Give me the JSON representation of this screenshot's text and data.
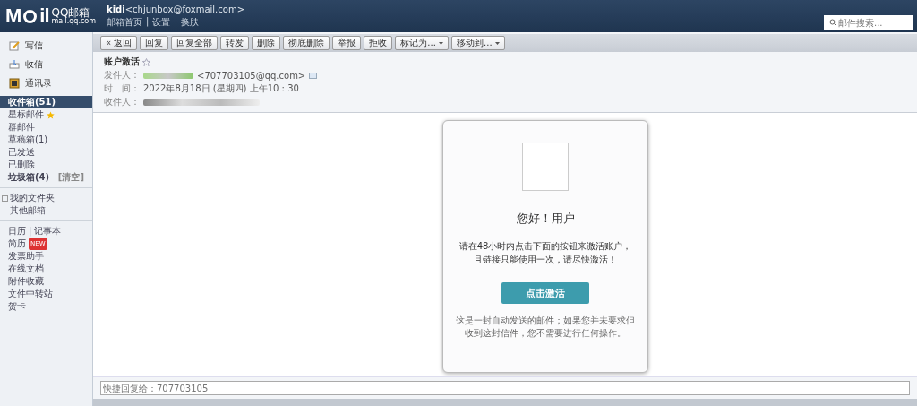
{
  "header": {
    "logo": "M",
    "logo_rest": "il",
    "brand": "QQ邮箱",
    "domain": "mail.qq.com",
    "user_name": "kidi",
    "user_email": "<chjunbox@foxmail.com>",
    "links": [
      {
        "label": "邮箱首页"
      },
      {
        "sep": "|",
        "label": "设置"
      },
      {
        "sep": "-",
        "label": "换肤"
      }
    ],
    "search": {
      "placeholder": "邮件搜索..."
    }
  },
  "sidebar": {
    "actions": [
      {
        "label": "写信",
        "kind": "write"
      },
      {
        "label": "收信",
        "kind": "receive"
      },
      {
        "label": "通讯录",
        "kind": "contacts"
      }
    ],
    "folders": [
      {
        "label": "收件箱(51)",
        "selected": true,
        "bold": true
      },
      {
        "label": "星标邮件",
        "selected": false,
        "bold": false,
        "star": true
      },
      {
        "label": "群邮件",
        "selected": false,
        "bold": false
      },
      {
        "label": "草稿箱(1)",
        "selected": false,
        "bold": false
      },
      {
        "label": "已发送",
        "selected": false,
        "bold": false
      },
      {
        "label": "已删除",
        "selected": false,
        "bold": false
      },
      {
        "label": "垃圾箱(4)",
        "selected": false,
        "bold": true,
        "action": "[清空]"
      }
    ],
    "groups": [
      {
        "label": "我的文件夹",
        "expanded": false
      },
      {
        "label": "其他邮箱"
      }
    ],
    "tools": [
      {
        "label": "日历",
        "sep": "|",
        "extra": "记事本"
      },
      {
        "label": "简历",
        "badge": "NEW"
      },
      {
        "label": "发票助手"
      },
      {
        "label": "在线文档"
      },
      {
        "label": "附件收藏"
      },
      {
        "label": "文件中转站"
      },
      {
        "label": "贺卡"
      }
    ]
  },
  "toolbar": [
    {
      "label": "« 返回",
      "dropdown": false
    },
    {
      "label": "回复",
      "dropdown": false
    },
    {
      "label": "回复全部",
      "dropdown": false
    },
    {
      "label": "转发",
      "dropdown": false
    },
    {
      "label": "删除",
      "dropdown": false
    },
    {
      "label": "彻底删除",
      "dropdown": false
    },
    {
      "label": "举报",
      "dropdown": false
    },
    {
      "label": "拒收",
      "dropdown": false
    },
    {
      "label": "标记为...",
      "dropdown": true
    },
    {
      "label": "移动到...",
      "dropdown": true
    }
  ],
  "message": {
    "subject": "账户激活",
    "starred": false,
    "from_label": "发件人：",
    "from_email": "<707703105@qq.com>",
    "time_label": "时　间：",
    "time": "2022年8月18日 (星期四) 上午10 : 30",
    "to_label": "收件人：",
    "card": {
      "greeting": "您好！用户",
      "text": "请在48小时内点击下面的按钮来激活账户，且链接只能使用一次，请尽快激活！",
      "button": "点击激活",
      "footer": "这是一封自动发送的邮件；如果您并未要求但收到这封信件，您不需要进行任何操作。"
    }
  },
  "quick_reply": {
    "placeholder": "快捷回复给：707703105"
  }
}
